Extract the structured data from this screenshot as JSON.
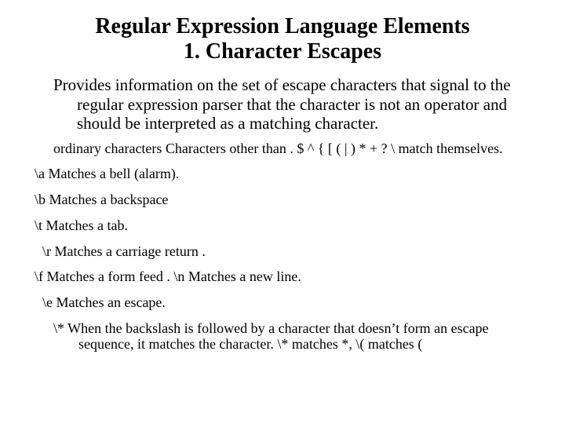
{
  "title_line1": "Regular Expression Language Elements",
  "title_line2": "1. Character Escapes",
  "intro": "Provides information on the set of escape characters that signal to the regular expression parser that the character is not an operator and should be interpreted as a matching character.",
  "items": [
    "ordinary characters Characters other than . $ ^ { [ ( | ) * + ? \\ match themselves.",
    "\\a Matches a bell (alarm).",
    "\\b Matches a backspace",
    "\\t Matches a tab.",
    "\\r Matches a carriage return .",
    "\\f Matches a form feed . \\n Matches a new line.",
    "\\e Matches an escape.",
    "\\* When the backslash is followed by a character that doesn’t form an escape sequence, it matches the character.  \\* matches *, \\( matches ("
  ]
}
